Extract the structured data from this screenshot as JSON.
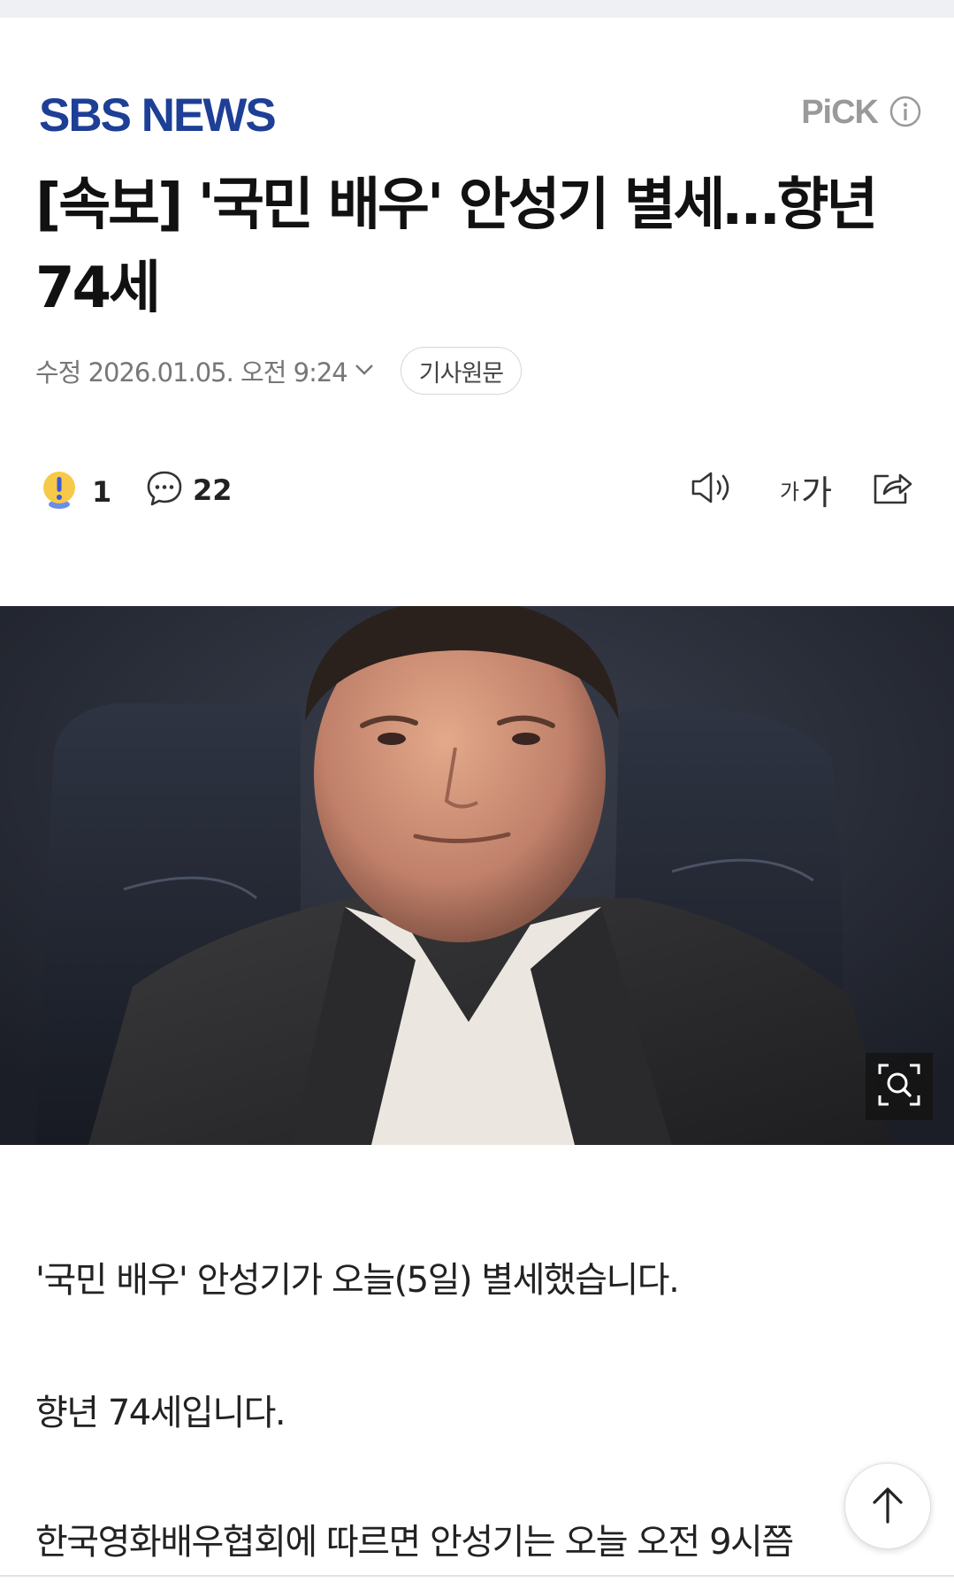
{
  "header": {
    "logo_text": "SBS NEWS",
    "pick_label": "PiCK",
    "brand_color": "#1e3f96"
  },
  "article": {
    "headline": "[속보] '국민 배우' 안성기 별세…향년 74세",
    "timestamp": "수정 2026.01.05. 오전 9:24",
    "original_button": "기사원문",
    "reaction_count": "1",
    "comment_count": "22",
    "font_size_small": "가",
    "font_size_big": "가",
    "paragraphs": [
      "'국민 배우' 안성기가 오늘(5일) 별세했습니다.",
      "향년 74세입니다.",
      "한국영화배우협회에 따르면 안성기는 오늘 오전 9시쯤"
    ]
  },
  "icons": {
    "info": "info-icon",
    "chevron": "chevron-down-icon",
    "reaction": "exclamation-reaction-icon",
    "comment": "comment-bubble-icon",
    "speaker": "speaker-icon",
    "share": "share-icon",
    "zoom": "zoom-search-icon",
    "scroll_top": "arrow-up-icon"
  }
}
